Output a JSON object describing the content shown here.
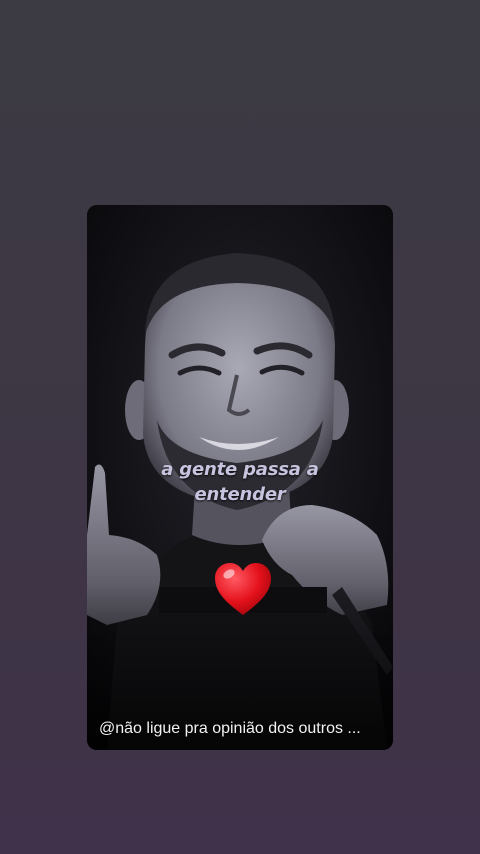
{
  "story": {
    "caption_line1": "a gente passa a",
    "caption_line2": "entender",
    "sticker": "red-heart-icon",
    "footer_text": "@não ligue pra opinião dos outros ..."
  }
}
